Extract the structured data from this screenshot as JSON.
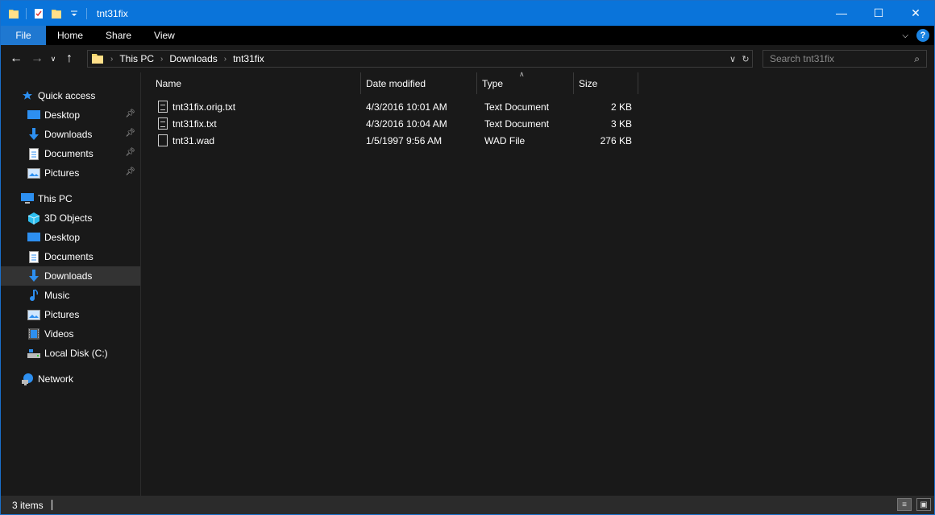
{
  "window": {
    "title": "tnt31fix",
    "controls": {
      "minimize": "—",
      "maximize": "☐",
      "close": "✕"
    }
  },
  "ribbon": {
    "tabs": [
      "File",
      "Home",
      "Share",
      "View"
    ],
    "help": "?"
  },
  "address": {
    "crumbs": [
      "This PC",
      "Downloads",
      "tnt31fix"
    ]
  },
  "search": {
    "placeholder": "Search tnt31fix"
  },
  "sidebar": {
    "quick_access": {
      "label": "Quick access",
      "items": [
        {
          "label": "Desktop",
          "icon": "desktop-icon",
          "pinned": true
        },
        {
          "label": "Downloads",
          "icon": "downloads-icon",
          "pinned": true
        },
        {
          "label": "Documents",
          "icon": "documents-icon",
          "pinned": true
        },
        {
          "label": "Pictures",
          "icon": "pictures-icon",
          "pinned": true
        }
      ]
    },
    "this_pc": {
      "label": "This PC",
      "items": [
        {
          "label": "3D Objects",
          "icon": "3d-objects-icon"
        },
        {
          "label": "Desktop",
          "icon": "desktop-icon"
        },
        {
          "label": "Documents",
          "icon": "documents-icon"
        },
        {
          "label": "Downloads",
          "icon": "downloads-icon",
          "selected": true
        },
        {
          "label": "Music",
          "icon": "music-icon"
        },
        {
          "label": "Pictures",
          "icon": "pictures-icon"
        },
        {
          "label": "Videos",
          "icon": "videos-icon"
        },
        {
          "label": "Local Disk (C:)",
          "icon": "drive-icon"
        }
      ]
    },
    "network": {
      "label": "Network"
    }
  },
  "columns": {
    "name": "Name",
    "date": "Date modified",
    "type": "Type",
    "size": "Size"
  },
  "files": [
    {
      "name": "tnt31fix.orig.txt",
      "date": "4/3/2016 10:01 AM",
      "type": "Text Document",
      "size": "2 KB",
      "icon": "text-file-icon"
    },
    {
      "name": "tnt31fix.txt",
      "date": "4/3/2016 10:04 AM",
      "type": "Text Document",
      "size": "3 KB",
      "icon": "text-file-icon"
    },
    {
      "name": "tnt31.wad",
      "date": "1/5/1997 9:56 AM",
      "type": "WAD File",
      "size": "276 KB",
      "icon": "file-icon"
    }
  ],
  "status": {
    "items": "3 items"
  }
}
